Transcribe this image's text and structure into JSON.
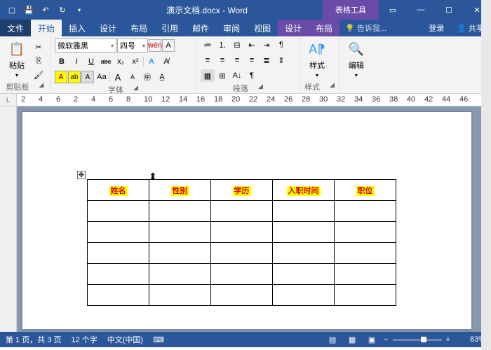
{
  "titlebar": {
    "title": "演示文档.docx - Word",
    "contextual": "表格工具"
  },
  "tabs": {
    "file": "文件",
    "home": "开始",
    "insert": "插入",
    "design": "设计",
    "layout": "布局",
    "references": "引用",
    "mailings": "邮件",
    "review": "审阅",
    "view": "视图",
    "t_design": "设计",
    "t_layout": "布局",
    "tell": "告诉我...",
    "login": "登录",
    "share": "共享"
  },
  "ribbon": {
    "clipboard": {
      "paste": "粘贴",
      "label": "剪贴板"
    },
    "font": {
      "name": "微软雅黑",
      "size": "四号",
      "label": "字体",
      "bold": "B",
      "italic": "I",
      "underline": "U",
      "strike": "abc",
      "sub": "x₂",
      "sup": "x²",
      "a_big": "A",
      "a_small": "A",
      "wen": "wén",
      "boxA": "A",
      "aa": "Aa",
      "a1": "A",
      "a2": "A"
    },
    "paragraph": {
      "label": "段落"
    },
    "styles": {
      "btn": "样式",
      "label": "样式"
    },
    "editing": {
      "btn": "编辑"
    }
  },
  "ruler": {
    "side": "L",
    "ticks": [
      "2",
      "4",
      "6",
      "2",
      "4",
      "6",
      "8",
      "10",
      "12",
      "14",
      "16",
      "18",
      "20",
      "22",
      "24",
      "26",
      "28",
      "30",
      "32",
      "34",
      "36",
      "38",
      "40",
      "42",
      "44",
      "46"
    ]
  },
  "table": {
    "headers": [
      "姓名",
      "性别",
      "学历",
      "入职时间",
      "职位"
    ],
    "rows": 5
  },
  "status": {
    "page": "第 1 页，共 3 页",
    "words": "12 个字",
    "lang": "中文(中国)",
    "zoom": "83%"
  }
}
